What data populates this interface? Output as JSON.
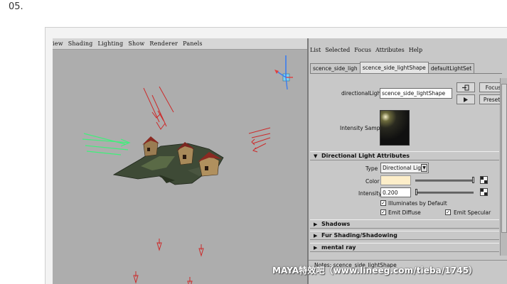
{
  "step_label": "05.",
  "viewport": {
    "menu": [
      "iew",
      "Shading",
      "Lighting",
      "Show",
      "Renderer",
      "Panels"
    ]
  },
  "attribute_editor": {
    "menu": [
      "List",
      "Selected",
      "Focus",
      "Attributes",
      "Help"
    ],
    "tabs": [
      {
        "label": "scence_side_ligh",
        "active": false
      },
      {
        "label": "scence_side_lightShape",
        "active": true
      },
      {
        "label": "defaultLightSet",
        "active": false
      }
    ],
    "node_label": "directionalLight:",
    "node_value": "scence_side_lightShape",
    "focus_button": "Focus",
    "presets_button": "Presets",
    "intensity_sample_label": "Intensity Sample",
    "sections": {
      "directional": "Directional Light Attributes",
      "shadows": "Shadows",
      "fur": "Fur Shading/Shadowing",
      "mental_ray": "mental ray"
    },
    "type_label": "Type",
    "type_value": "Directional Light",
    "color_label": "Color",
    "color_value": "#fdeec9",
    "intensity_label": "Intensity",
    "intensity_value": "0.200",
    "illuminates_label": "Illuminates by Default",
    "emit_diffuse_label": "Emit Diffuse",
    "emit_specular_label": "Emit Specular",
    "notes_label": "Notes:  scence_side_lightShape"
  },
  "watermark": "MAYA特效吧（www.lineeg.com/tieba/1745）"
}
